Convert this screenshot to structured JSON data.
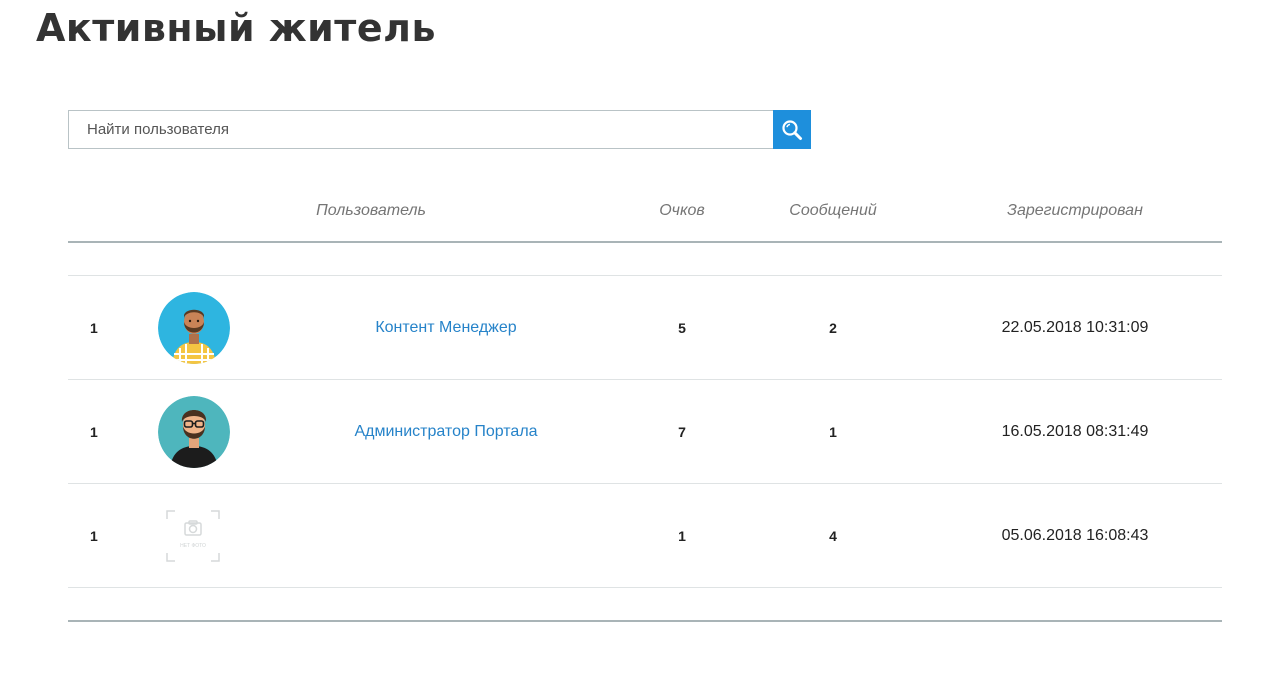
{
  "page": {
    "title": "Активный житель"
  },
  "search": {
    "placeholder": "Найти пользователя",
    "value": "",
    "button_icon": "search-icon",
    "button_color": "#1e8fdc"
  },
  "table": {
    "headers": {
      "user": "Пользователь",
      "points": "Очков",
      "messages": "Сообщений",
      "registered": "Зарегистрирован"
    },
    "rows": [
      {
        "rank": "1",
        "avatar": "avatar-man-beard-icon",
        "name": "Контент Менеджер",
        "points": "5",
        "messages": "2",
        "registered": "22.05.2018 10:31:09"
      },
      {
        "rank": "1",
        "avatar": "avatar-man-glasses-icon",
        "name": "Администратор Портала",
        "points": "7",
        "messages": "1",
        "registered": "16.05.2018 08:31:49"
      },
      {
        "rank": "1",
        "avatar": "no-photo-icon",
        "no_photo_label": "НЕТ ФОТО",
        "name": "",
        "points": "1",
        "messages": "4",
        "registered": "05.06.2018 16:08:43"
      }
    ]
  },
  "colors": {
    "link": "#2683c9",
    "header_text": "#757575",
    "divider": "#a9b4b7",
    "avatar_bg_1": "#2eb5e0",
    "avatar_bg_2": "#4eb6bd"
  }
}
